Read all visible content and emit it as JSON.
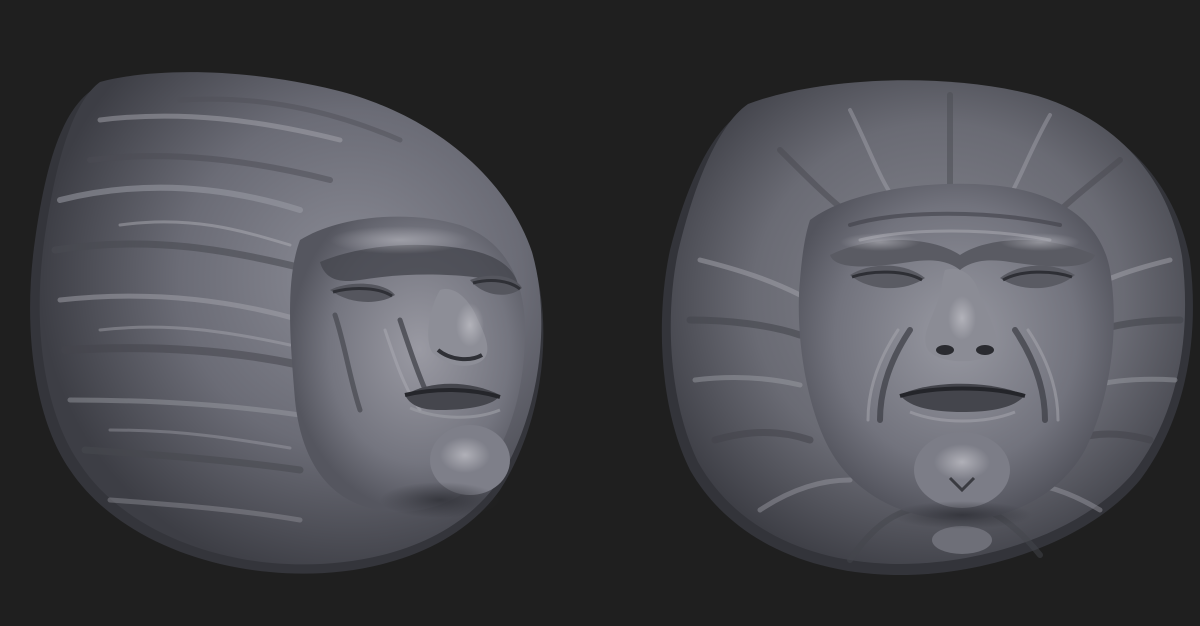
{
  "viewport": {
    "background": "#1f1f1f",
    "material_color": "#7b7c86",
    "material_highlight": "#a8a8b0",
    "material_shadow": "#3c3d44"
  },
  "models": [
    {
      "id": "left-face",
      "view": "three-quarter"
    },
    {
      "id": "right-face",
      "view": "front"
    }
  ]
}
